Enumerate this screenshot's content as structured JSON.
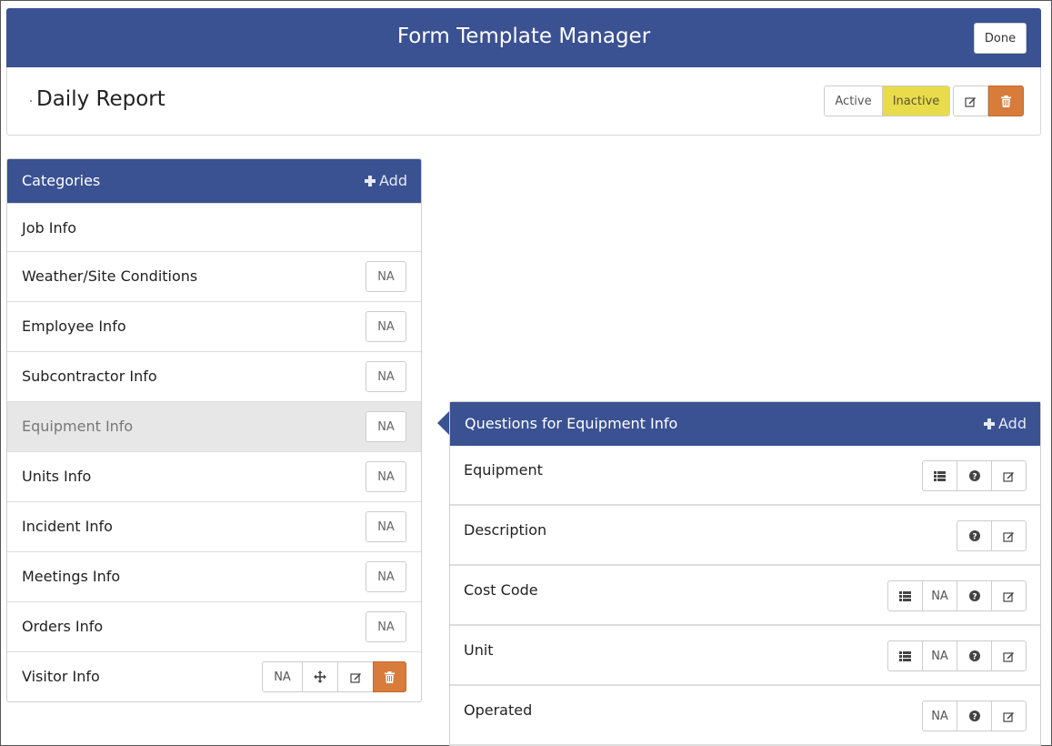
{
  "header": {
    "title": "Form Template Manager",
    "done_label": "Done"
  },
  "template": {
    "name": "Daily Report",
    "status_active": "Active",
    "status_inactive": "Inactive",
    "selected_status": "Inactive"
  },
  "categories": {
    "title": "Categories",
    "add_label": "Add",
    "items": [
      {
        "label": "Job Info"
      },
      {
        "label": "Weather/Site Conditions",
        "na": "NA"
      },
      {
        "label": "Employee Info",
        "na": "NA"
      },
      {
        "label": "Subcontractor Info",
        "na": "NA"
      },
      {
        "label": "Equipment Info",
        "na": "NA",
        "selected": true
      },
      {
        "label": "Units Info",
        "na": "NA"
      },
      {
        "label": "Incident Info",
        "na": "NA"
      },
      {
        "label": "Meetings Info",
        "na": "NA"
      },
      {
        "label": "Orders Info",
        "na": "NA"
      },
      {
        "label": "Visitor Info",
        "na": "NA"
      }
    ]
  },
  "questions": {
    "title": "Questions for Equipment Info",
    "add_label": "Add",
    "items": [
      {
        "label": "Equipment"
      },
      {
        "label": "Description"
      },
      {
        "label": "Cost Code",
        "na": "NA"
      },
      {
        "label": "Unit",
        "na": "NA"
      },
      {
        "label": "Operated",
        "na": "NA"
      }
    ]
  },
  "colors": {
    "header_blue": "#3a5192",
    "inactive_yellow": "#e8dc4a",
    "delete_orange": "#d87c3b",
    "selected_row": "#e7e7e7"
  }
}
